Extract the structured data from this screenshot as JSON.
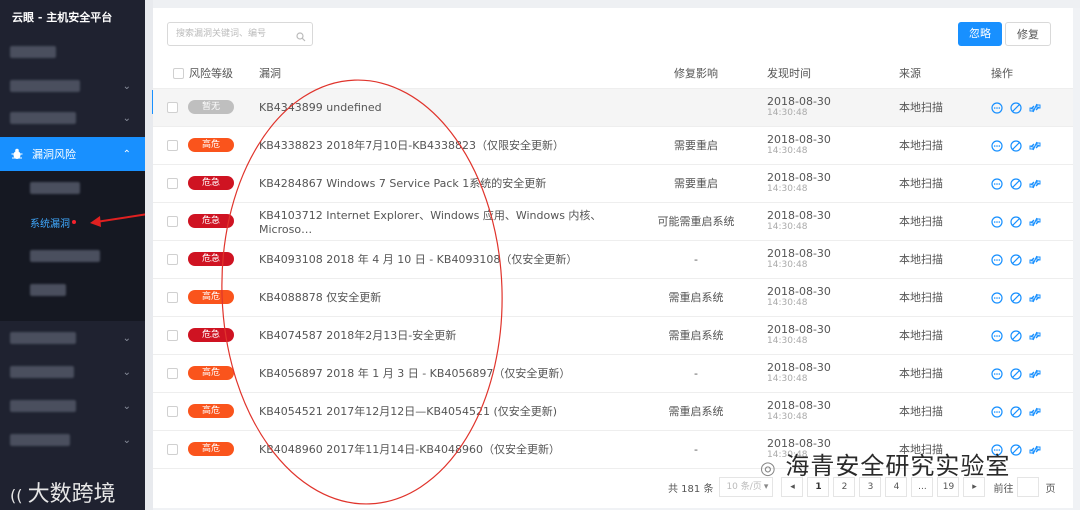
{
  "app": {
    "title": "云眼 - 主机安全平台"
  },
  "sidebar": {
    "active_item": {
      "label": "漏洞风险"
    },
    "sub_active": {
      "label": "系统漏洞"
    }
  },
  "toolbar": {
    "search_placeholder": "搜索漏洞关键词、编号",
    "ignore_label": "忽略",
    "fix_label": "修复"
  },
  "table": {
    "columns": [
      "风险等级",
      "漏洞",
      "修复影响",
      "发现时间",
      "来源",
      "操作"
    ],
    "rows": [
      {
        "level": "暂无",
        "level_color": "#bfbfbf",
        "vuln": "KB4343899 undefined",
        "impact": "",
        "date": "2018-08-30",
        "time": "14:30:48",
        "source": "本地扫描"
      },
      {
        "level": "高危",
        "level_color": "#fa541c",
        "vuln": "KB4338823 2018年7月10日-KB4338823（仅限安全更新）",
        "impact": "需要重启",
        "date": "2018-08-30",
        "time": "14:30:48",
        "source": "本地扫描"
      },
      {
        "level": "危急",
        "level_color": "#cf1322",
        "vuln": "KB4284867 Windows 7 Service Pack 1系统的安全更新",
        "impact": "需要重启",
        "date": "2018-08-30",
        "time": "14:30:48",
        "source": "本地扫描"
      },
      {
        "level": "危急",
        "level_color": "#cf1322",
        "vuln": "KB4103712 Internet Explorer、Windows 应用、Windows 内核、Microso…",
        "impact": "可能需重启系统",
        "date": "2018-08-30",
        "time": "14:30:48",
        "source": "本地扫描"
      },
      {
        "level": "危急",
        "level_color": "#cf1322",
        "vuln": "KB4093108 2018 年 4 月 10 日 - KB4093108（仅安全更新）",
        "impact": "-",
        "date": "2018-08-30",
        "time": "14:30:48",
        "source": "本地扫描"
      },
      {
        "level": "高危",
        "level_color": "#fa541c",
        "vuln": "KB4088878 仅安全更新",
        "impact": "需重启系统",
        "date": "2018-08-30",
        "time": "14:30:48",
        "source": "本地扫描"
      },
      {
        "level": "危急",
        "level_color": "#cf1322",
        "vuln": "KB4074587 2018年2月13日-安全更新",
        "impact": "需重启系统",
        "date": "2018-08-30",
        "time": "14:30:48",
        "source": "本地扫描"
      },
      {
        "level": "高危",
        "level_color": "#fa541c",
        "vuln": "KB4056897 2018 年 1 月 3 日 - KB4056897（仅安全更新）",
        "impact": "-",
        "date": "2018-08-30",
        "time": "14:30:48",
        "source": "本地扫描"
      },
      {
        "level": "高危",
        "level_color": "#fa541c",
        "vuln": "KB4054521 2017年12月12日—KB4054521 (仅安全更新)",
        "impact": "需重启系统",
        "date": "2018-08-30",
        "time": "14:30:48",
        "source": "本地扫描"
      },
      {
        "level": "高危",
        "level_color": "#fa541c",
        "vuln": "KB4048960 2017年11月14日-KB4048960（仅安全更新）",
        "impact": "-",
        "date": "2018-08-30",
        "time": "14:30:48",
        "source": "本地扫描"
      }
    ]
  },
  "pagination": {
    "total": "共 181 条",
    "page_size": "10 条/页",
    "pages": [
      "1",
      "2",
      "3",
      "4",
      "...",
      "19"
    ],
    "goto_label": "前往",
    "page_suffix": "页"
  },
  "watermark": {
    "text": "海青安全研究实验室",
    "bottom_left": "大数跨境"
  },
  "colors": {
    "accent": "#1890ff",
    "critical": "#cf1322",
    "high": "#fa541c",
    "none": "#bfbfbf",
    "sidebar": "#1f2230"
  }
}
